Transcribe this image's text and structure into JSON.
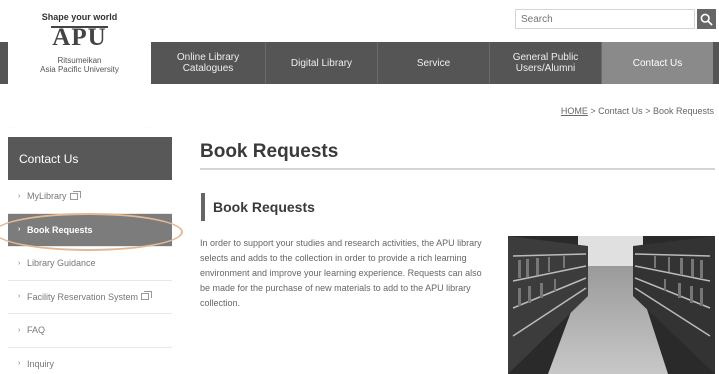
{
  "logo": {
    "tagline": "Shape your world",
    "mark": "APU",
    "name": "Ritsumeikan\nAsia Pacific University"
  },
  "search": {
    "placeholder": "Search"
  },
  "nav": {
    "items": [
      {
        "label": "Online Library\nCatalogues"
      },
      {
        "label": "Digital Library"
      },
      {
        "label": "Service"
      },
      {
        "label": "General Public\nUsers/Alumni"
      },
      {
        "label": "Contact Us"
      }
    ]
  },
  "breadcrumb": {
    "home": "HOME",
    "sep1": " > ",
    "level1": "Contact Us",
    "sep2": " > ",
    "current": "Book Requests"
  },
  "sidebar": {
    "title": "Contact Us",
    "bullet": "›",
    "items": [
      {
        "label": "MyLibrary"
      },
      {
        "label": "Book Requests"
      },
      {
        "label": "Library Guidance"
      },
      {
        "label": "Facility Reservation System"
      },
      {
        "label": "FAQ"
      },
      {
        "label": "Inquiry"
      }
    ]
  },
  "main": {
    "page_title": "Book Requests",
    "section_title": "Book Requests",
    "body": "In order to support your studies and research activities, the APU library selects and adds to the collection in order to provide a rich learning environment and improve your learning experience. Requests can also be made for the purchase of new materials to add to the APU library collection."
  },
  "colors": {
    "nav_bg": "#555555",
    "nav_active": "#8a8a8a",
    "sidebar_head": "#585858",
    "sidebar_selected": "#7c7c7c",
    "highlight_ring": "#e3b995"
  },
  "icons": {
    "search": "magnifier-icon",
    "external": "external-window-icon"
  }
}
